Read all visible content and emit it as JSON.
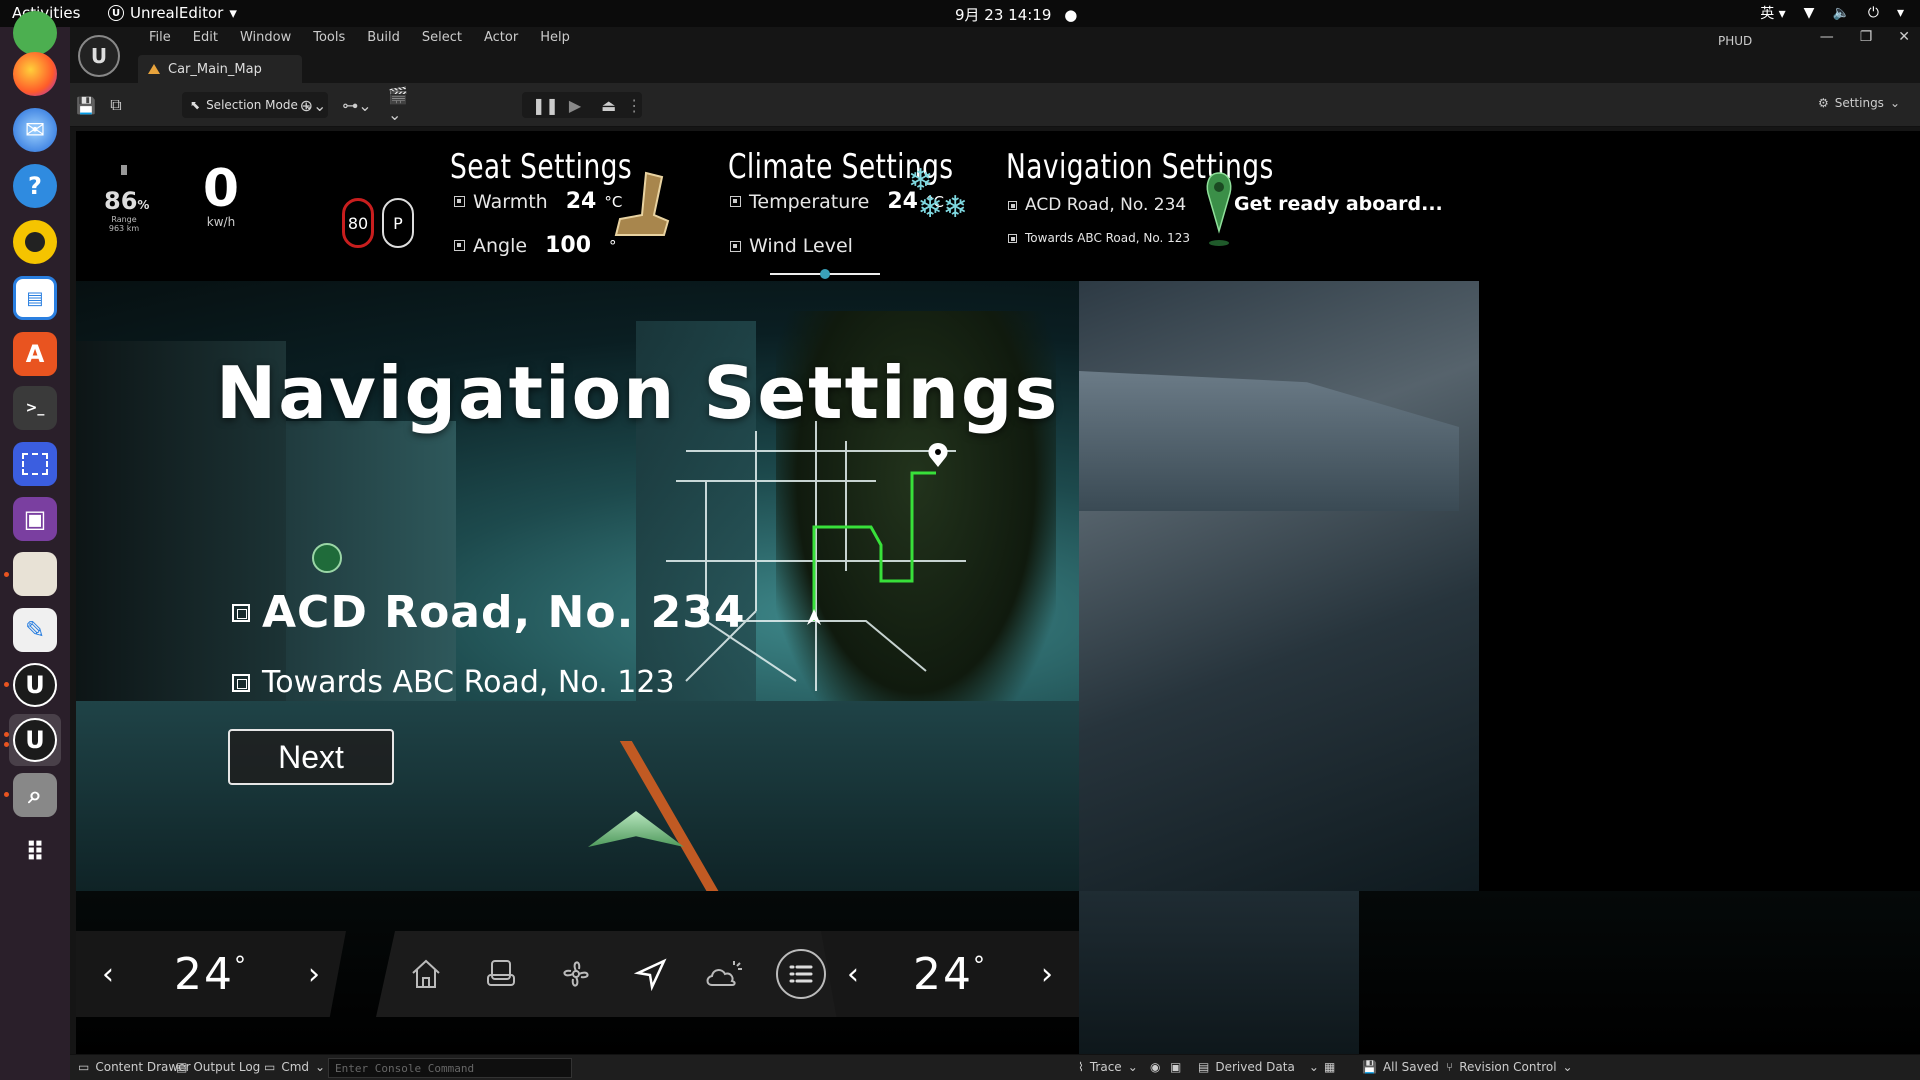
{
  "topbar": {
    "activities": "Activities",
    "app_name": "UnrealEditor",
    "clock": "9月 23  14:19",
    "input_method": "英"
  },
  "dock": {
    "items": [
      {
        "name": "chrome",
        "color": "#4caf50"
      },
      {
        "name": "firefox",
        "color": "#ff7139"
      },
      {
        "name": "thunderbird",
        "color": "#2a7fe0"
      },
      {
        "name": "help",
        "color": "#2f8be0"
      },
      {
        "name": "rhythmbox",
        "color": "#f5c400"
      },
      {
        "name": "writer",
        "color": "#2a7fe0"
      },
      {
        "name": "app-center",
        "color": "#e95420"
      },
      {
        "name": "terminal",
        "color": "#3a3a3a"
      },
      {
        "name": "screenshot",
        "color": "#3b5ee0"
      },
      {
        "name": "video",
        "color": "#7a3fa0"
      },
      {
        "name": "files",
        "color": "#e8e2d6"
      },
      {
        "name": "text-editor",
        "color": "#f0f0f0"
      },
      {
        "name": "unreal-1",
        "color": "#1b1b1b"
      },
      {
        "name": "unreal-2",
        "color": "#1b1b1b"
      },
      {
        "name": "search",
        "color": "#888888"
      }
    ]
  },
  "editor": {
    "menu": [
      "File",
      "Edit",
      "Window",
      "Tools",
      "Build",
      "Select",
      "Actor",
      "Help"
    ],
    "tab": "Car_Main_Map",
    "project": "PHUD",
    "selection_mode": "Selection Mode",
    "settings": "Settings"
  },
  "hud": {
    "battery_pct": "86",
    "battery_unit": "%",
    "range": "Range 963 km",
    "speed": "0",
    "speed_unit": "kw/h",
    "speed_limit": "80",
    "gear": "P",
    "seat": {
      "title": "Seat Settings",
      "warmth_label": "Warmth",
      "warmth_value": "24",
      "warmth_unit": "°C",
      "angle_label": "Angle",
      "angle_value": "100",
      "angle_unit": "°"
    },
    "climate": {
      "title": "Climate Settings",
      "temp_label": "Temperature",
      "temp_value": "24",
      "temp_unit": "°C",
      "wind_label": "Wind Level",
      "wind_level": 0.45
    },
    "navigation": {
      "title": "Navigation Settings",
      "road": "ACD Road, No. 234",
      "towards": "Towards ABC Road, No. 123"
    },
    "status": "Get ready aboard..."
  },
  "scene": {
    "title": "Navigation Settings",
    "road": "ACD Road, No. 234",
    "towards": "Towards ABC Road, No. 123",
    "next": "Next"
  },
  "bottom": {
    "left_temp": "24",
    "right_temp": "24",
    "degree": "°",
    "nav_icons": [
      "home",
      "seat",
      "fan",
      "navigate",
      "weather",
      "menu"
    ]
  },
  "statusbar": {
    "content_drawer": "Content Drawer",
    "output_log": "Output Log",
    "cmd": "Cmd",
    "console_placeholder": "Enter Console Command",
    "trace": "Trace",
    "derived_data": "Derived Data",
    "all_saved": "All Saved",
    "revision_control": "Revision Control"
  }
}
